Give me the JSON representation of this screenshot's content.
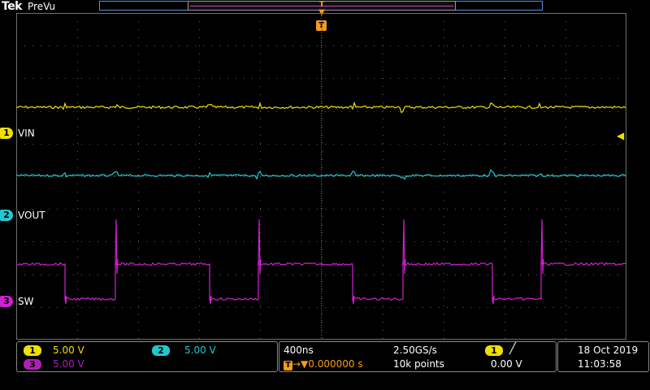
{
  "header": {
    "brand": "Tek",
    "mode": "PreVu",
    "trigger_marker": "T"
  },
  "colors": {
    "ch1": "#f0e000",
    "ch2": "#20c8d0",
    "ch3": "#d020d0",
    "trigger": "#f59b1f",
    "grid": "#6f6f6f"
  },
  "channels": [
    {
      "number": "1",
      "name": "VIN",
      "scale": "5.00 V"
    },
    {
      "number": "2",
      "name": "VOUT",
      "scale": "5.00 V"
    },
    {
      "number": "3",
      "name": "SW",
      "scale": "5.00 V"
    }
  ],
  "timebase": {
    "horizontal_scale": "400ns",
    "sample_rate": "2.50GS/s",
    "position": "0.000000 s",
    "record_length": "10k points"
  },
  "trigger": {
    "source": "1",
    "slope_icon": "rising-edge-icon",
    "level": "0.00 V"
  },
  "datetime": {
    "date": "18 Oct  2019",
    "time": "11:03:58"
  }
}
